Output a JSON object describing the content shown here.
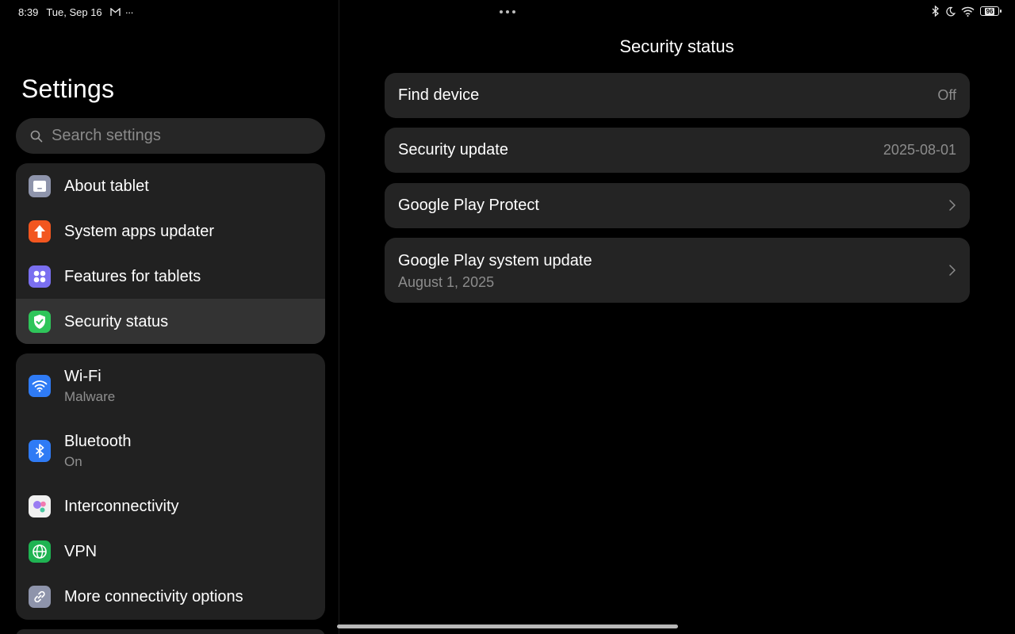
{
  "status_bar": {
    "time": "8:39",
    "date": "Tue, Sep 16",
    "more": "···",
    "battery": "96",
    "icons": [
      "gmail-icon",
      "bluetooth-icon",
      "do-not-disturb-moon-icon",
      "wifi-icon",
      "battery-icon"
    ]
  },
  "sidebar": {
    "title": "Settings",
    "search_placeholder": "Search settings",
    "group1": [
      {
        "label": "About tablet",
        "icon": "tablet-icon",
        "color": "#8e94ab"
      },
      {
        "label": "System apps updater",
        "icon": "arrow-up-icon",
        "color": "#f2561f"
      },
      {
        "label": "Features for tablets",
        "icon": "grid-dots-icon",
        "color": "#7a6ff0"
      },
      {
        "label": "Security status",
        "icon": "shield-check-icon",
        "color": "#2fc55a"
      }
    ],
    "group2": [
      {
        "label": "Wi-Fi",
        "sub": "Malware",
        "icon": "wifi-icon",
        "color": "#2f7bf5"
      },
      {
        "label": "Bluetooth",
        "sub": "On",
        "icon": "bluetooth-icon",
        "color": "#2f7bf5"
      },
      {
        "label": "Interconnectivity",
        "icon": "interconnectivity-icon",
        "color": "#f0f0f0"
      },
      {
        "label": "VPN",
        "icon": "globe-icon",
        "color": "#1fb352"
      },
      {
        "label": "More connectivity options",
        "icon": "link-icon",
        "color": "#8e94ab"
      }
    ]
  },
  "detail": {
    "title": "Security status",
    "items": [
      {
        "label": "Find device",
        "value": "Off"
      },
      {
        "label": "Security update",
        "value": "2025-08-01"
      },
      {
        "label": "Google Play Protect"
      },
      {
        "label": "Google Play system update",
        "sub": "August 1, 2025"
      }
    ]
  }
}
